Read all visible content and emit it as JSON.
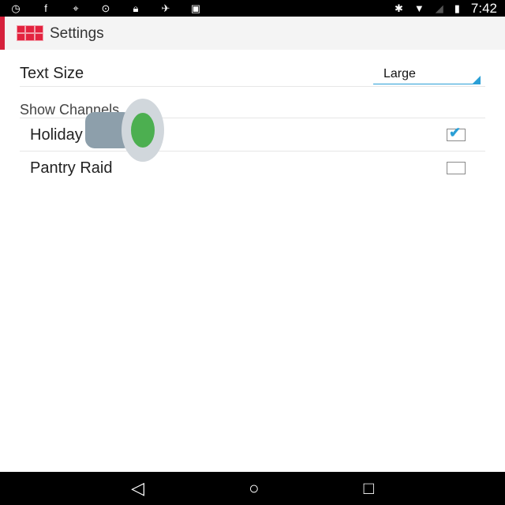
{
  "status_bar": {
    "time": "7:42",
    "icons_left": [
      "clock-icon",
      "facebook-icon",
      "maps-icon",
      "sync-icon",
      "lock-icon",
      "satellite-icon",
      "android-icon"
    ],
    "icons_right": [
      "bluetooth-icon",
      "wifi-icon",
      "no-signal-icon",
      "battery-charging-icon"
    ]
  },
  "app_bar": {
    "title": "Settings"
  },
  "settings": {
    "text_size": {
      "label": "Text Size",
      "value": "Large"
    },
    "section_header": "Show Channels",
    "channels": [
      {
        "label": "Holiday Baking",
        "checked": true
      },
      {
        "label": "Pantry Raid",
        "checked": false
      }
    ]
  },
  "nav_bar": {
    "buttons": [
      "back",
      "home",
      "recents"
    ]
  }
}
